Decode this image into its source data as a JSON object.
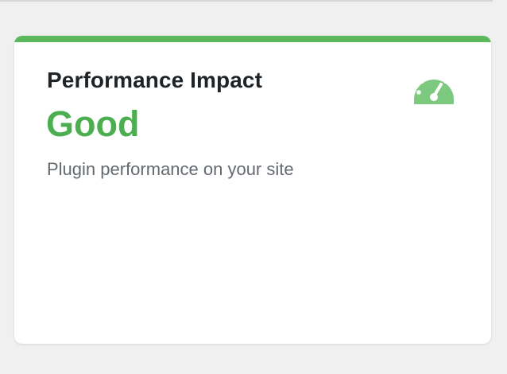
{
  "card": {
    "title": "Performance Impact",
    "status": "Good",
    "description": "Plugin performance on your site",
    "icon": "dashboard-gauge-icon",
    "accent_color": "#5bb85c",
    "status_color": "#4bae4f",
    "icon_color": "#7dc97f"
  }
}
